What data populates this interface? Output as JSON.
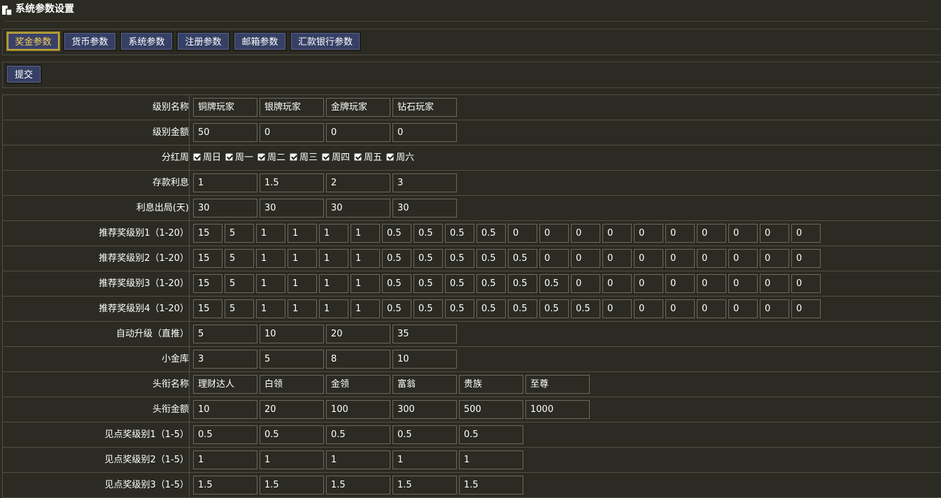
{
  "header": {
    "title": "系统参数设置"
  },
  "tabs": [
    {
      "label": "奖金参数",
      "active": true
    },
    {
      "label": "货币参数",
      "active": false
    },
    {
      "label": "系统参数",
      "active": false
    },
    {
      "label": "注册参数",
      "active": false
    },
    {
      "label": "邮箱参数",
      "active": false
    },
    {
      "label": "汇款银行参数",
      "active": false
    }
  ],
  "submit_label": "提交",
  "checkbox_states": [
    true,
    true,
    true,
    true,
    true,
    true,
    true
  ],
  "rows": [
    {
      "label": "级别名称",
      "kind": "wide",
      "values": [
        "铜牌玩家",
        "银牌玩家",
        "金牌玩家",
        "钻石玩家"
      ]
    },
    {
      "label": "级别金额",
      "kind": "wide",
      "values": [
        "50",
        "0",
        "0",
        "0"
      ]
    },
    {
      "label": "分红周",
      "kind": "check",
      "values": [
        "周日",
        "周一",
        "周二",
        "周三",
        "周四",
        "周五",
        "周六"
      ]
    },
    {
      "label": "存款利息",
      "kind": "wide",
      "values": [
        "1",
        "1.5",
        "2",
        "3"
      ]
    },
    {
      "label": "利息出局(天)",
      "kind": "wide",
      "values": [
        "30",
        "30",
        "30",
        "30"
      ]
    },
    {
      "label": "推荐奖级别1（1-20）",
      "kind": "small",
      "values": [
        "15",
        "5",
        "1",
        "1",
        "1",
        "1",
        "0.5",
        "0.5",
        "0.5",
        "0.5",
        "0",
        "0",
        "0",
        "0",
        "0",
        "0",
        "0",
        "0",
        "0",
        "0"
      ]
    },
    {
      "label": "推荐奖级别2（1-20）",
      "kind": "small",
      "values": [
        "15",
        "5",
        "1",
        "1",
        "1",
        "1",
        "0.5",
        "0.5",
        "0.5",
        "0.5",
        "0.5",
        "0",
        "0",
        "0",
        "0",
        "0",
        "0",
        "0",
        "0",
        "0"
      ]
    },
    {
      "label": "推荐奖级别3（1-20）",
      "kind": "small",
      "values": [
        "15",
        "5",
        "1",
        "1",
        "1",
        "1",
        "0.5",
        "0.5",
        "0.5",
        "0.5",
        "0.5",
        "0.5",
        "0",
        "0",
        "0",
        "0",
        "0",
        "0",
        "0",
        "0"
      ]
    },
    {
      "label": "推荐奖级别4（1-20）",
      "kind": "small",
      "values": [
        "15",
        "5",
        "1",
        "1",
        "1",
        "1",
        "0.5",
        "0.5",
        "0.5",
        "0.5",
        "0.5",
        "0.5",
        "0.5",
        "0",
        "0",
        "0",
        "0",
        "0",
        "0",
        "0"
      ]
    },
    {
      "label": "自动升级（直推）",
      "kind": "wide",
      "values": [
        "5",
        "10",
        "20",
        "35"
      ]
    },
    {
      "label": "小金库",
      "kind": "wide",
      "values": [
        "3",
        "5",
        "8",
        "10"
      ]
    },
    {
      "label": "头衔名称",
      "kind": "wide",
      "values": [
        "理财达人",
        "白领",
        "金领",
        "富翁",
        "贵族",
        "至尊"
      ]
    },
    {
      "label": "头衔金额",
      "kind": "wide",
      "values": [
        "10",
        "20",
        "100",
        "300",
        "500",
        "1000"
      ]
    },
    {
      "label": "见点奖级别1（1-5）",
      "kind": "wide",
      "values": [
        "0.5",
        "0.5",
        "0.5",
        "0.5",
        "0.5"
      ]
    },
    {
      "label": "见点奖级别2（1-5）",
      "kind": "wide",
      "values": [
        "1",
        "1",
        "1",
        "1",
        "1"
      ]
    },
    {
      "label": "见点奖级别3（1-5）",
      "kind": "wide",
      "values": [
        "1.5",
        "1.5",
        "1.5",
        "1.5",
        "1.5"
      ]
    }
  ]
}
